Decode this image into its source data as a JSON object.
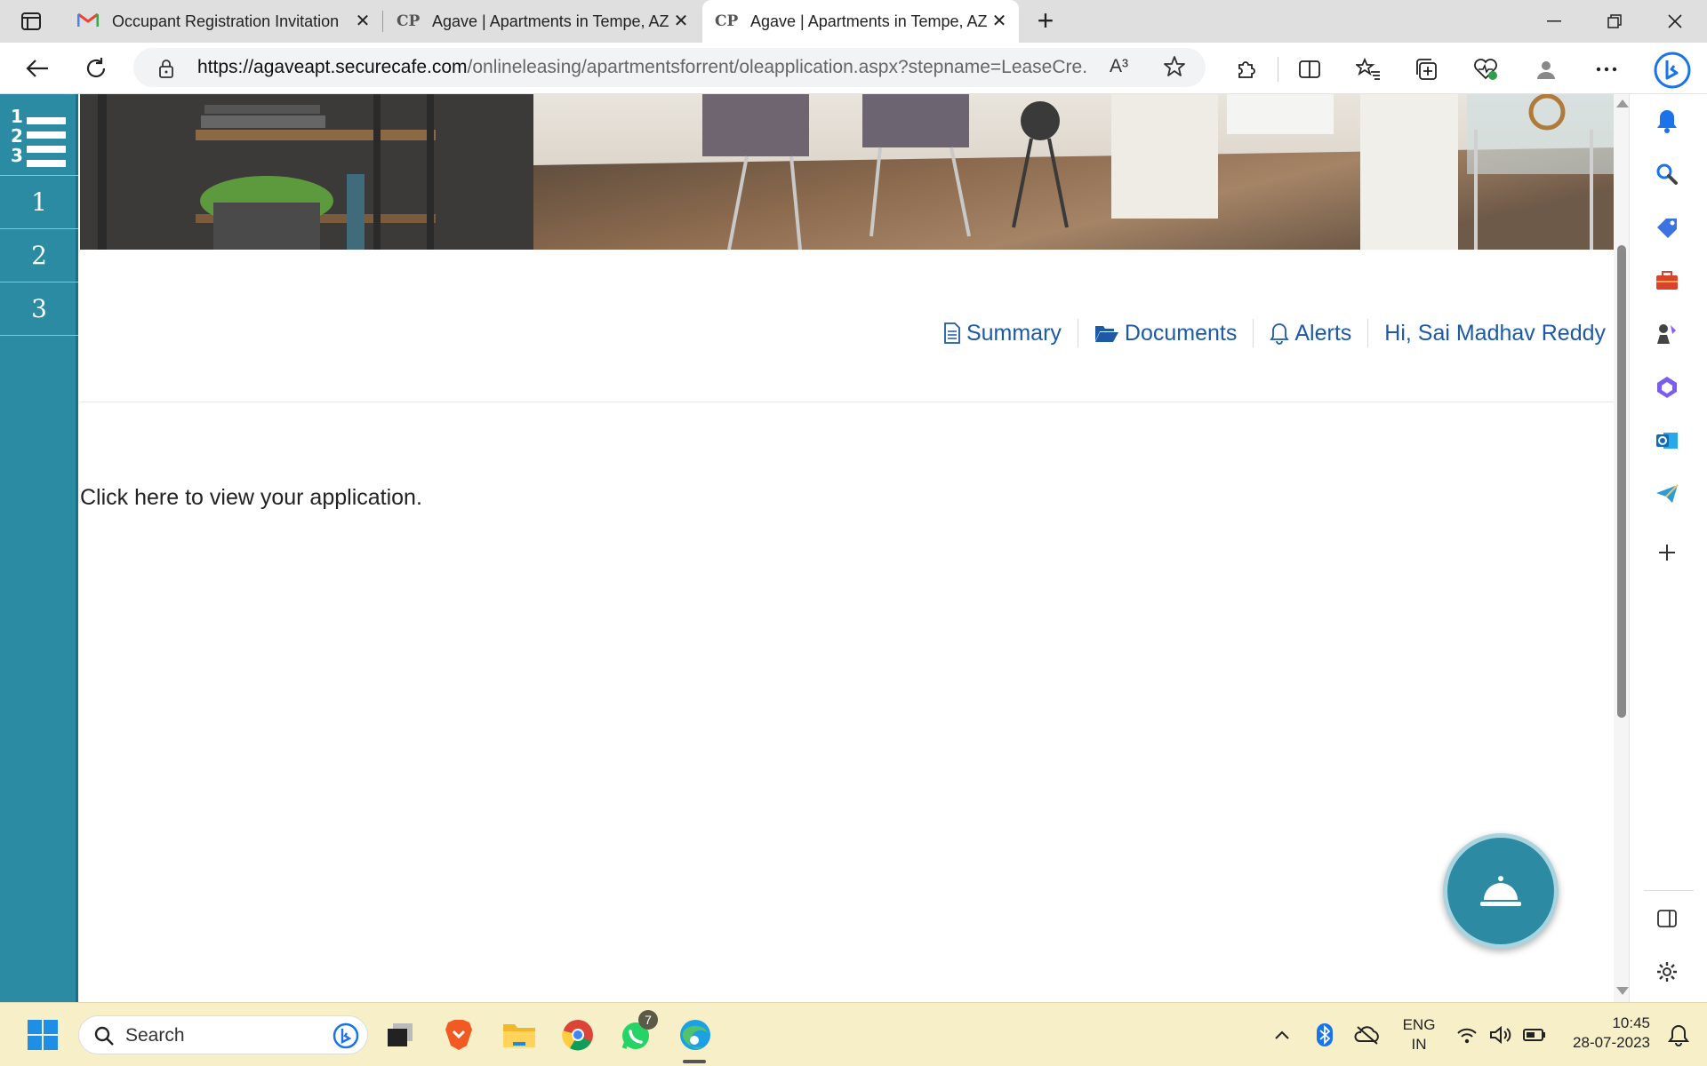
{
  "browser": {
    "tabs": [
      {
        "title": "Occupant Registration Invitation",
        "favicon": "gmail-icon"
      },
      {
        "title": "Agave | Apartments in Tempe, AZ",
        "favicon": "CP"
      },
      {
        "title": "Agave | Apartments in Tempe, AZ",
        "favicon": "CP",
        "active": true
      }
    ],
    "url_host": "https://agaveapt.securecafe.com",
    "url_path": "/onlineleasing/apartmentsforrent/oleapplication.aspx?stepname=LeaseCre...",
    "read_aloud": "A³"
  },
  "steps": {
    "items": [
      "1",
      "2",
      "3"
    ],
    "menu_icon": "numbered-list-icon"
  },
  "nav": {
    "summary": "Summary",
    "documents": "Documents",
    "alerts": "Alerts",
    "greeting": "Hi, Sai Madhav Reddy"
  },
  "main": {
    "view_application": "Click here to view your application."
  },
  "taskbar": {
    "search_placeholder": "Search",
    "whatsapp_badge": "7",
    "lang_line1": "ENG",
    "lang_line2": "IN",
    "time": "10:45",
    "date": "28-07-2023"
  },
  "colors": {
    "accent": "#2a8ba3",
    "link": "#1c5aa6",
    "taskbar": "#f6efc8"
  }
}
